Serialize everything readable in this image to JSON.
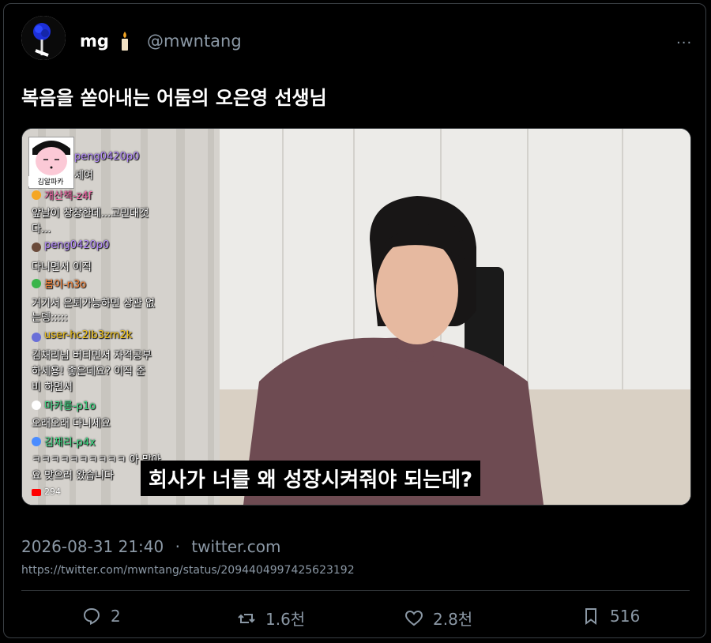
{
  "author": {
    "name": "mg",
    "handle": "@mwntang",
    "avatar_icon": "blue-rose-avatar",
    "name_emoji": "candle-icon"
  },
  "more_label": "···",
  "post_text": "복음을 쏟아내는 어둠의 오은영 선생님",
  "video": {
    "subtitle": "회사가 너를 왜 성장시켜줘야 되는데?",
    "stamp_label": "김알파카",
    "viewer_count": "294",
    "chat": [
      {
        "user": "peng0420p0",
        "msg": "세여"
      },
      {
        "user": "개산책-z4f",
        "msg": "앞날이 창창한데...고민대갯",
        "msg2": "다..."
      },
      {
        "user": "peng0420p0",
        "msg": "다니면서 이직"
      },
      {
        "user": "봄이-n3o",
        "msg": "거기서 은퇴가능하면 상관 없",
        "msg2": "는뎅:::::"
      },
      {
        "user": "user-hc2lb3zm2k",
        "msg": "김채리님 버티면서 자격공부",
        "msg2": "하세용! 좋은데요? 이직 준",
        "msg3": "비 하면서"
      },
      {
        "user": "마카롱-p1o",
        "msg": "오래오래 다니세요"
      },
      {
        "user": "김채리-p4x",
        "msg": "ㅋㅋㅋㅋㅋㅋㅋㅋㅋㅋ 아 맞아",
        "msg2": "요 맞으러 왔습니다"
      }
    ]
  },
  "timestamp": "2026-08-31 21:40",
  "separator": "·",
  "source": "twitter.com",
  "url": "https://twitter.com/mwntang/status/2094404997425623192",
  "actions": {
    "replies": "2",
    "retweets": "1.6천",
    "likes": "2.8천",
    "bookmarks": "516"
  },
  "colors": {
    "background": "#000000",
    "text": "#e7e9ea",
    "muted": "#8b98a5"
  }
}
